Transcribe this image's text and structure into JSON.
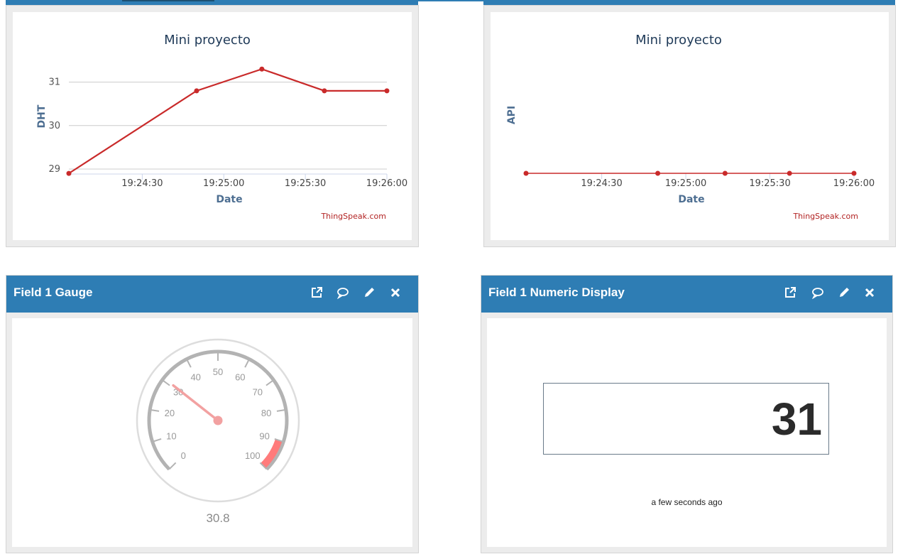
{
  "colors": {
    "header": "#2e7db4",
    "series": "#c92a2a",
    "gauge_band": "#ff7b7b",
    "needle": "#f2a1a1",
    "axis_title": "#4d6e91"
  },
  "chart_left": {
    "title": "Mini proyecto",
    "xlabel": "Date",
    "ylabel": "DHT",
    "credit": "ThingSpeak.com",
    "chart_data": {
      "type": "line",
      "title": "Mini proyecto",
      "xlabel": "Date",
      "ylabel": "DHT",
      "x_ticks": [
        "19:24:30",
        "19:25:00",
        "19:25:30",
        "19:26:00"
      ],
      "y_ticks": [
        29,
        30,
        31
      ],
      "ylim": [
        28.8,
        31.4
      ],
      "grid": true,
      "series": [
        {
          "x": [
            "19:24:03",
            "19:24:50",
            "19:25:14",
            "19:25:37",
            "19:26:00"
          ],
          "values": [
            28.9,
            30.8,
            31.3,
            30.8,
            30.8
          ]
        }
      ]
    }
  },
  "chart_right": {
    "title": "Mini proyecto",
    "xlabel": "Date",
    "ylabel": "API",
    "credit": "ThingSpeak.com",
    "chart_data": {
      "type": "line",
      "title": "Mini proyecto",
      "xlabel": "Date",
      "ylabel": "API",
      "x_ticks": [
        "19:24:30",
        "19:25:00",
        "19:25:30",
        "19:26:00"
      ],
      "y_ticks": [],
      "grid": false,
      "series": [
        {
          "x": [
            "19:24:03",
            "19:24:50",
            "19:25:14",
            "19:25:37",
            "19:26:00"
          ],
          "values": [
            0,
            0,
            0,
            0,
            0
          ]
        }
      ]
    }
  },
  "gauge_widget": {
    "title": "Field 1 Gauge",
    "value": 30.8,
    "value_label": "30.8",
    "min": 0,
    "max": 100,
    "tick_labels": [
      "0",
      "10",
      "20",
      "30",
      "40",
      "50",
      "60",
      "70",
      "80",
      "90",
      "100"
    ],
    "band": {
      "from": 90,
      "to": 100
    },
    "icons": [
      "external-link-icon",
      "comment-icon",
      "pencil-icon",
      "close-icon"
    ]
  },
  "numeric_widget": {
    "title": "Field 1 Numeric Display",
    "value": "31",
    "timestamp": "a few seconds ago",
    "icons": [
      "external-link-icon",
      "comment-icon",
      "pencil-icon",
      "close-icon"
    ]
  }
}
